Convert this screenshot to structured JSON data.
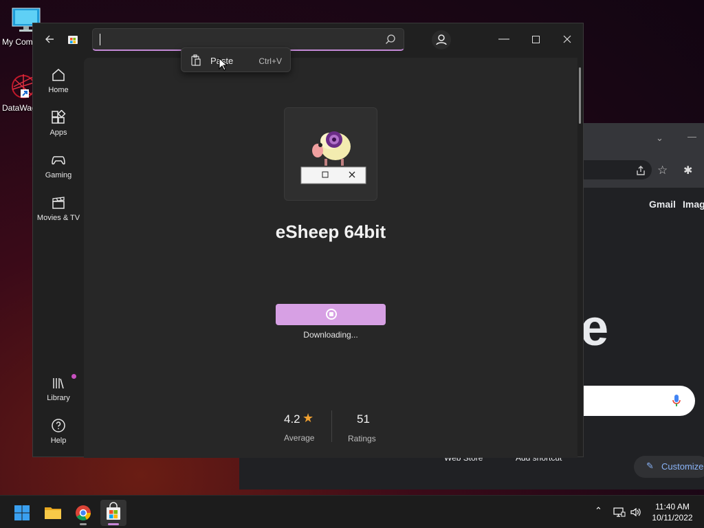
{
  "desktop": {
    "icons": [
      {
        "label": "My Com",
        "icon": "computer-icon"
      },
      {
        "label": "DataWag",
        "icon": "datawag-icon"
      }
    ]
  },
  "chrome": {
    "links": [
      "Gmail",
      "Image"
    ],
    "logo_fragment": "e",
    "shortcuts": [
      "Web Store",
      "Add shortcut"
    ],
    "customize_label": "Customize"
  },
  "store": {
    "search": {
      "value": "",
      "placeholder": ""
    },
    "context_menu": {
      "label": "Paste",
      "shortcut": "Ctrl+V"
    },
    "nav": [
      {
        "label": "Home",
        "icon": "home-icon"
      },
      {
        "label": "Apps",
        "icon": "apps-icon"
      },
      {
        "label": "Gaming",
        "icon": "gamepad-icon"
      },
      {
        "label": "Movies & TV",
        "icon": "clapper-icon"
      },
      {
        "label": "Library",
        "icon": "library-icon"
      },
      {
        "label": "Help",
        "icon": "help-icon"
      }
    ],
    "app": {
      "title": "eSheep 64bit",
      "status": "Downloading...",
      "rating": "4.2",
      "rating_label": "Average",
      "ratings_count": "51",
      "ratings_label": "Ratings"
    },
    "accent": "#d7a0e4"
  },
  "taskbar": {
    "apps": [
      "start-icon",
      "file-explorer-icon",
      "chrome-icon",
      "store-icon"
    ],
    "time": "11:40 AM",
    "date": "10/11/2022"
  }
}
